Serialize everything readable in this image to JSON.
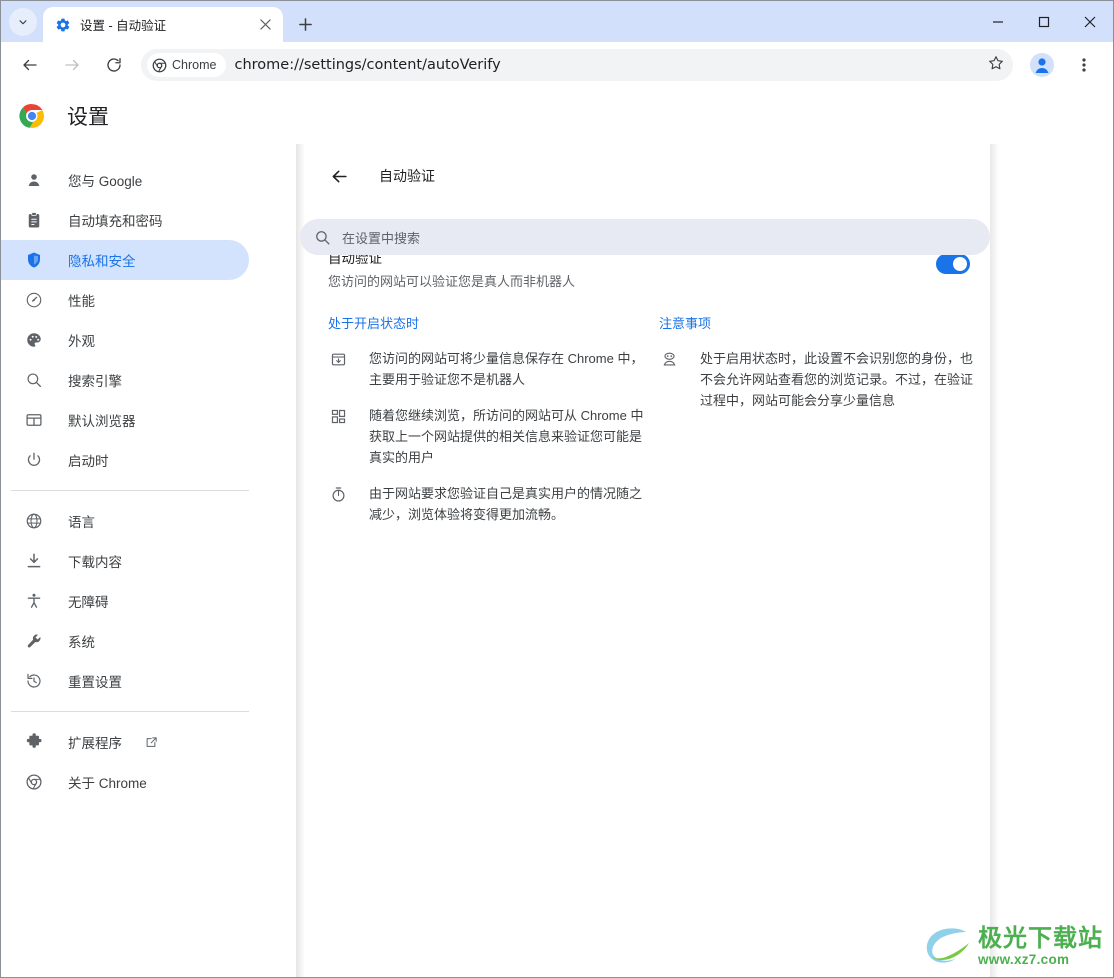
{
  "browser": {
    "tab": {
      "title": "设置 - 自动验证",
      "favicon_icon": "gear-icon",
      "close_icon": "close-icon"
    },
    "tab_search_icon": "chevron-down-icon",
    "new_tab_icon": "plus-icon",
    "window_controls": {
      "minimize_icon": "minimize-icon",
      "maximize_icon": "maximize-icon",
      "close_icon": "close-icon"
    },
    "toolbar": {
      "back_icon": "back-arrow-icon",
      "forward_icon": "forward-arrow-icon",
      "reload_icon": "reload-icon",
      "chip_label": "Chrome",
      "chip_icon": "chrome-icon",
      "url": "chrome://settings/content/autoVerify",
      "bookmark_icon": "star-icon",
      "profile_icon": "avatar-icon",
      "menu_icon": "three-dots-icon"
    },
    "accent_color": "#1a73e8",
    "tabstrip_color": "#d2e0fb"
  },
  "settings": {
    "logo_icon": "chrome-logo-icon",
    "title": "设置",
    "search": {
      "icon": "search-icon",
      "placeholder": "在设置中搜索",
      "value": ""
    },
    "sidebar": {
      "groups": [
        {
          "items": [
            {
              "label": "您与 Google",
              "icon": "person-icon",
              "selected": false
            },
            {
              "label": "自动填充和密码",
              "icon": "clipboard-icon",
              "selected": false
            },
            {
              "label": "隐私和安全",
              "icon": "shield-icon",
              "selected": true
            },
            {
              "label": "性能",
              "icon": "speedometer-icon",
              "selected": false
            },
            {
              "label": "外观",
              "icon": "palette-icon",
              "selected": false
            },
            {
              "label": "搜索引擎",
              "icon": "search-icon",
              "selected": false
            },
            {
              "label": "默认浏览器",
              "icon": "browser-window-icon",
              "selected": false
            },
            {
              "label": "启动时",
              "icon": "power-icon",
              "selected": false
            }
          ]
        },
        {
          "items": [
            {
              "label": "语言",
              "icon": "globe-icon",
              "selected": false
            },
            {
              "label": "下载内容",
              "icon": "download-icon",
              "selected": false
            },
            {
              "label": "无障碍",
              "icon": "accessibility-icon",
              "selected": false
            },
            {
              "label": "系统",
              "icon": "wrench-icon",
              "selected": false
            },
            {
              "label": "重置设置",
              "icon": "history-restore-icon",
              "selected": false
            }
          ]
        },
        {
          "items": [
            {
              "label": "扩展程序",
              "icon": "puzzle-icon",
              "selected": false,
              "external": true
            },
            {
              "label": "关于 Chrome",
              "icon": "chrome-outline-icon",
              "selected": false
            }
          ]
        }
      ]
    }
  },
  "subpage": {
    "back_icon": "back-arrow-icon",
    "title": "自动验证",
    "setting": {
      "label": "自动验证",
      "description": "您访问的网站可以验证您是真人而非机器人",
      "toggle_on": true,
      "toggle_color": "#1a73e8"
    },
    "columns": [
      {
        "heading": "处于开启状态时",
        "bullets": [
          {
            "icon": "save-to-inbox-icon",
            "text": "您访问的网站可将少量信息保存在 Chrome 中，主要用于验证您不是机器人"
          },
          {
            "icon": "dashboard-grid-icon",
            "text": "随着您继续浏览，所访问的网站可从 Chrome 中获取上一个网站提供的相关信息来验证您可能是真实的用户"
          },
          {
            "icon": "timer-icon",
            "text": "由于网站要求您验证自己是真实用户的情况随之减少，浏览体验将变得更加流畅。"
          }
        ]
      },
      {
        "heading": "注意事项",
        "bullets": [
          {
            "icon": "privacy-mask-icon",
            "text": "处于启用状态时，此设置不会识别您的身份，也不会允许网站查看您的浏览记录。不过，在验证过程中，网站可能会分享少量信息"
          }
        ]
      }
    ]
  },
  "watermark": {
    "logo_icon": "aurora-swoosh-icon",
    "title": "极光下载站",
    "url": "www.xz7.com",
    "color": "#4caf50"
  }
}
